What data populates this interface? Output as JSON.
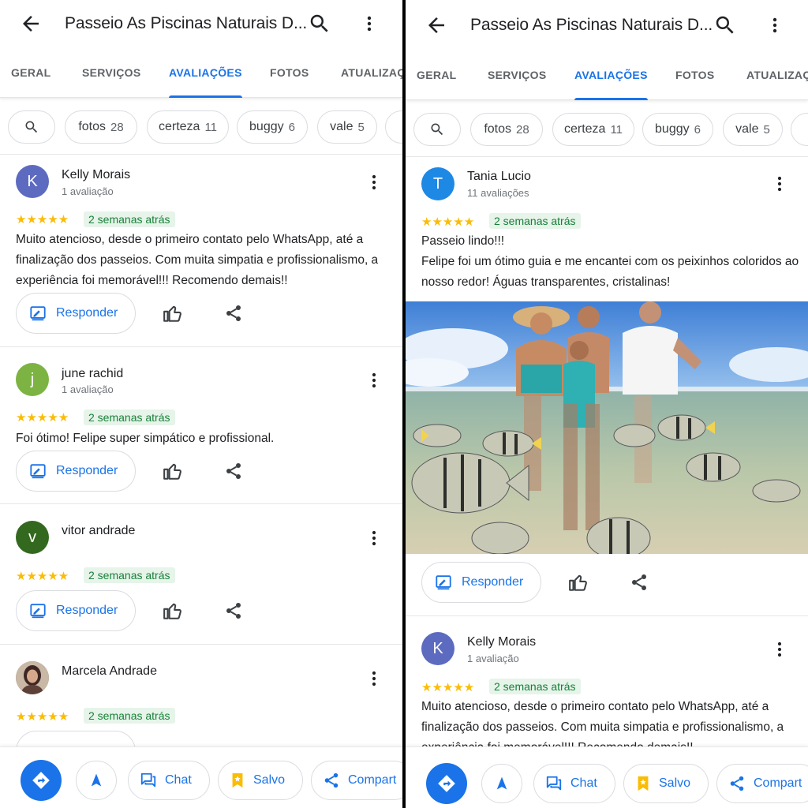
{
  "header": {
    "title": "Passeio As Piscinas Naturais D..."
  },
  "tabs": [
    {
      "label": "GERAL"
    },
    {
      "label": "SERVIÇOS"
    },
    {
      "label": "AVALIAÇÕES"
    },
    {
      "label": "FOTOS"
    },
    {
      "label": "ATUALIZAÇ"
    }
  ],
  "chips": [
    {
      "label": "fotos",
      "count": "28"
    },
    {
      "label": "certeza",
      "count": "11"
    },
    {
      "label": "buggy",
      "count": "6"
    },
    {
      "label": "vale",
      "count": "5"
    }
  ],
  "common": {
    "stars": "★★★★★",
    "reply_label": "Responder"
  },
  "left": {
    "reviews": [
      {
        "initial": "K",
        "name": "Kelly Morais",
        "count": "1 avaliação",
        "date": "2 semanas atrás",
        "text": "Muito atencioso, desde o primeiro contato pelo WhatsApp, até a finalização dos passeios. Com muita simpatia e profissionalismo, a experiência foi memorável!!! Recomendo demais!!",
        "avatar_color": "#5c6bc0"
      },
      {
        "initial": "j",
        "name": "june rachid",
        "count": "1 avaliação",
        "date": "2 semanas atrás",
        "text": "Foi ótimo! Felipe super simpático e profissional.",
        "avatar_color": "#7cb342"
      },
      {
        "initial": "v",
        "name": "vitor andrade",
        "count": "",
        "date": "2 semanas atrás",
        "text": "",
        "avatar_color": "#33691e"
      },
      {
        "initial": "",
        "name": "Marcela Andrade",
        "count": "",
        "date": "2 semanas atrás",
        "text": "",
        "avatar_color": "#8d6e63"
      }
    ]
  },
  "right": {
    "reviews": [
      {
        "initial": "T",
        "name": "Tania Lucio",
        "count": "11 avaliações",
        "date": "2 semanas atrás",
        "text_line1": "Passeio lindo!!!",
        "text_rest": "Felipe foi um ótimo guia e me encantei com os peixinhos coloridos ao nosso redor! Águas transparentes, cristalinas!",
        "avatar_color": "#1e88e5"
      },
      {
        "initial": "K",
        "name": "Kelly Morais",
        "count": "1 avaliação",
        "date": "2 semanas atrás",
        "text": "Muito atencioso, desde o primeiro contato pelo WhatsApp, até a finalização dos passeios. Com muita simpatia e profissionalismo, a experiência foi memorável!!! Recomendo demais!!",
        "avatar_color": "#5c6bc0"
      }
    ]
  },
  "bottombar": {
    "chat_label": "Chat",
    "saved_label": "Salvo",
    "share_label": "Compart"
  },
  "colors": {
    "accent": "#1a73e8",
    "star": "#fbbc04",
    "date_green": "#188038"
  }
}
